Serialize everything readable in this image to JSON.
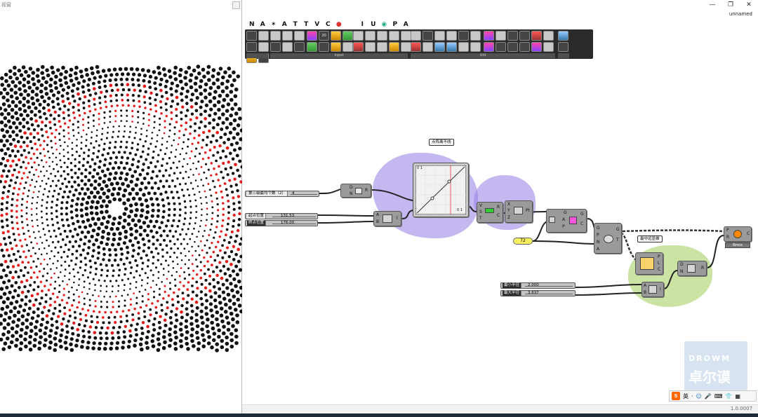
{
  "rhino_view": {
    "title": "视窗"
  },
  "gh_window": {
    "controls": {
      "minimize": "—",
      "restore": "❐",
      "close": "✕"
    },
    "document_name": "unnamed",
    "tabs": [
      "N",
      "A",
      "✶",
      "A",
      "T",
      "T",
      "V",
      "C",
      "",
      "",
      "I",
      "U",
      "",
      "P",
      "A"
    ],
    "toolbar_groups": [
      {
        "name": "",
        "buttons": [
          "",
          "",
          "",
          "",
          "",
          "",
          "",
          "",
          "",
          ""
        ]
      },
      {
        "name": "Input",
        "buttons": [
          "",
          "20",
          "",
          "",
          "",
          "",
          "",
          "",
          "",
          "",
          "",
          "",
          "",
          "",
          "",
          ""
        ]
      },
      {
        "name": "Util",
        "buttons": [
          "",
          "",
          "",
          "",
          "",
          "",
          "",
          "",
          "",
          "",
          "",
          "",
          "",
          "",
          "",
          "",
          "",
          ""
        ]
      }
    ],
    "status_version": "1.0.0007"
  },
  "canvas": {
    "params": [
      {
        "label": "第三级最均个数（2）",
        "value": "4",
        "dark": false
      },
      {
        "label": "起点位置",
        "value": "131.53",
        "dark": false
      },
      {
        "label": "终点位置",
        "value": "176.00",
        "dark": true
      },
      {
        "label": "最小半径",
        "value": "2.000",
        "dark": true
      },
      {
        "label": "最大半径",
        "value": "3.637",
        "dark": true
      }
    ],
    "yellow_param": "72",
    "groups": [
      {
        "tag": "点阵离不线"
      },
      {
        "tag": "最中远显维"
      }
    ],
    "graph_mapper": {
      "corner_tl": "0 1",
      "corner_br": "0 1"
    },
    "components": [
      {
        "name": "series",
        "ports_in": [
          "D",
          "N"
        ],
        "ports_out": [
          "R"
        ]
      },
      {
        "name": "range",
        "ports_in": [
          "A",
          "B"
        ],
        "ports_out": [
          "I"
        ]
      },
      {
        "name": "remap",
        "ports_in": [
          "V",
          "S",
          "T"
        ],
        "ports_out": [
          "R",
          "C"
        ]
      },
      {
        "name": "divide",
        "ports_in": [
          "X",
          "Y",
          "Z"
        ],
        "ports_out": [
          "Pt"
        ]
      },
      {
        "name": "list-item",
        "ports_in": [
          "G",
          "A",
          "P"
        ],
        "ports_out": [
          "G",
          "C"
        ]
      },
      {
        "name": "polar-array",
        "ports_in": [
          "G",
          "P",
          "N",
          "A"
        ],
        "ports_out": [
          "G",
          "T"
        ]
      },
      {
        "name": "construct-domain",
        "ports_in": [
          "A",
          "B"
        ],
        "ports_out": [
          "I"
        ]
      },
      {
        "name": "graph-mapper-2",
        "ports_in": [
          "",
          ""
        ],
        "ports_out": [
          "P",
          "L",
          "C"
        ]
      },
      {
        "name": "series-2",
        "ports_in": [
          "D",
          "N"
        ],
        "ports_out": [
          "R"
        ]
      },
      {
        "name": "circle",
        "ports_in": [
          "P",
          "R"
        ],
        "ports_out": [
          "C"
        ]
      },
      {
        "name": "bmix",
        "label": "Bmix"
      }
    ]
  },
  "watermark": {
    "line1": "DROWM",
    "line2": "卓尔谟"
  },
  "ime": {
    "logo": "S",
    "lang": "英",
    "icons": [
      "·",
      "☺",
      "🎤",
      "⌨",
      "👕",
      "▦"
    ]
  },
  "colors": {
    "dot_black": "#111111",
    "dot_red": "#e51c1c",
    "group_purple": "#967de6",
    "group_green": "#a0cd5a",
    "component_gray": "#9a9a9a"
  }
}
